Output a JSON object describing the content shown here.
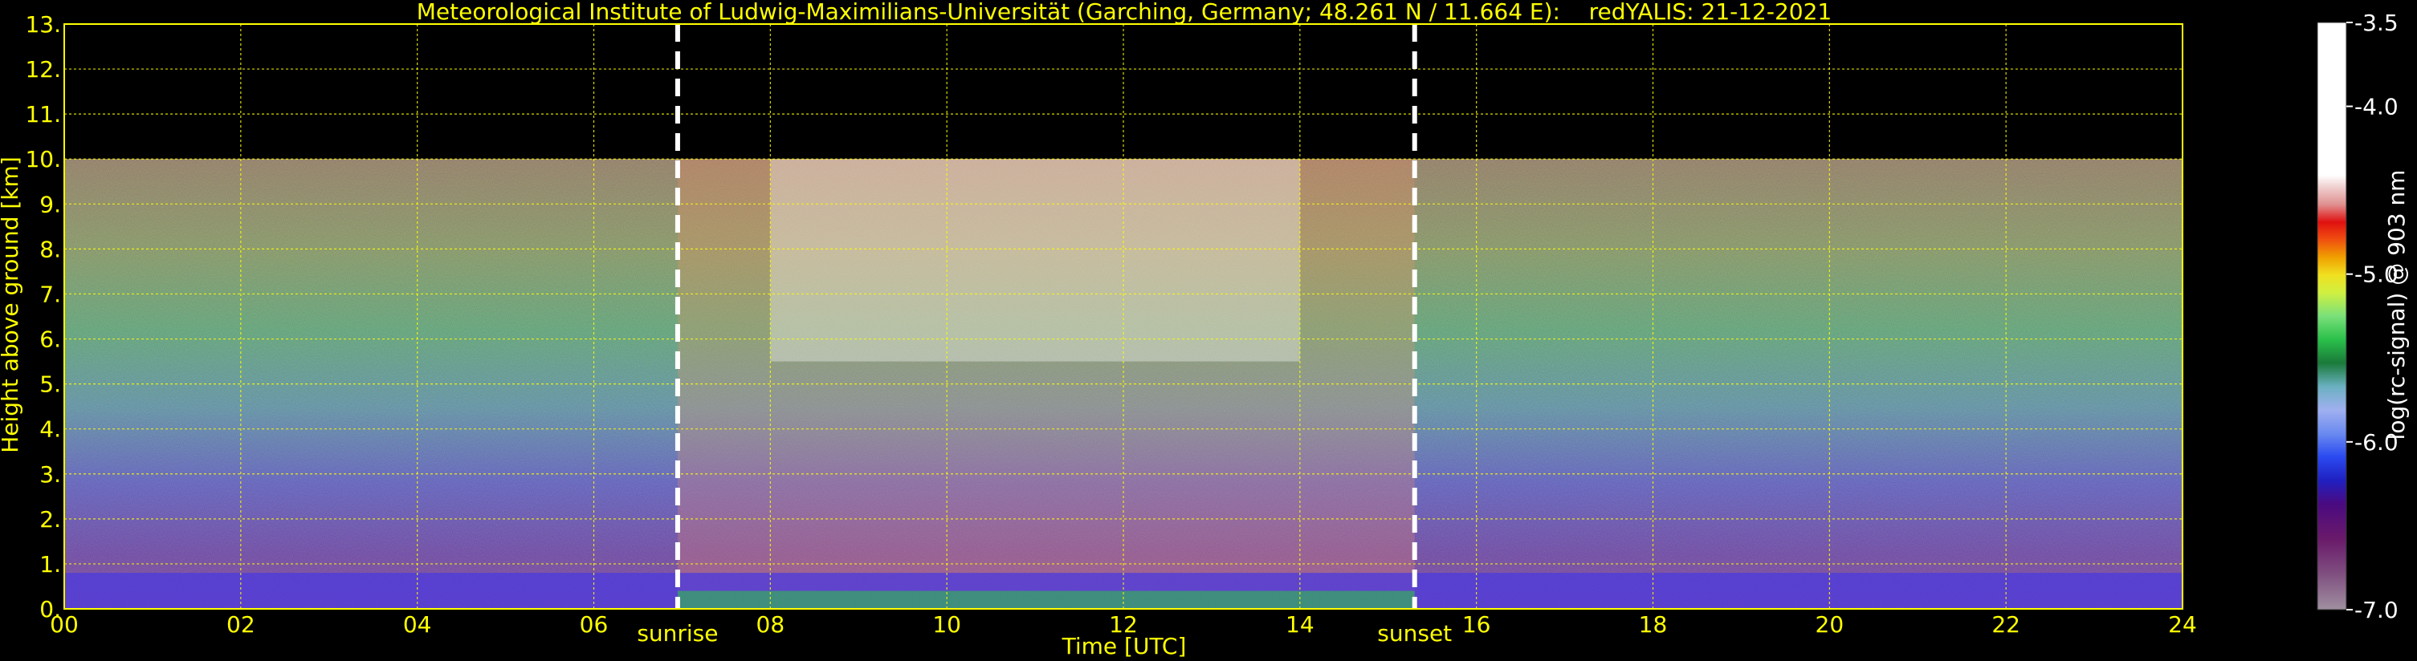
{
  "chart_data": {
    "type": "heatmap",
    "title": "Meteorological Institute of Ludwig-Maximilians-Universität (Garching, Germany; 48.261 N / 11.664 E):    redYALIS: 21-12-2021",
    "xlabel": "Time [UTC]",
    "ylabel": "Height above ground [km]",
    "xlim": [
      0,
      24
    ],
    "ylim": [
      0,
      13
    ],
    "x_ticks": [
      0,
      2,
      4,
      6,
      8,
      10,
      12,
      14,
      16,
      18,
      20,
      22,
      24
    ],
    "x_tick_labels": [
      "00",
      "02",
      "04",
      "06",
      "08",
      "10",
      "12",
      "14",
      "16",
      "18",
      "20",
      "22",
      "24"
    ],
    "y_ticks": [
      0,
      1,
      2,
      3,
      4,
      5,
      6,
      7,
      8,
      9,
      10,
      11,
      12,
      13
    ],
    "y_tick_labels": [
      "0.",
      "1.",
      "2.",
      "3.",
      "4.",
      "5.",
      "6.",
      "7.",
      "8.",
      "9.",
      "10.",
      "11.",
      "12.",
      "13."
    ],
    "grid": true,
    "data_top_km": 10.0,
    "markers": [
      {
        "label": "sunrise",
        "time_h": 6.95
      },
      {
        "label": "sunset",
        "time_h": 15.3
      }
    ],
    "colorbar": {
      "label": "log(rc-signal) @ 903 nm",
      "range": [
        -7.0,
        -3.5
      ],
      "tick_values": [
        -3.5,
        -4.0,
        -5.0,
        -6.0,
        -7.0
      ],
      "tick_labels": [
        "-3.5",
        "-4.0",
        "-5.0",
        "-6.0",
        "-7.0"
      ]
    }
  },
  "colors": {
    "axis_text": "#ffff00",
    "grid": "#ffff00",
    "marker_line": "#ffffff",
    "background": "#000000"
  }
}
